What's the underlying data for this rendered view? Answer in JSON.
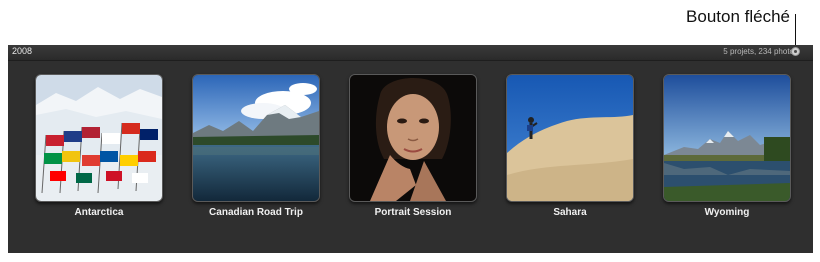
{
  "callout": {
    "label": "Bouton fléché"
  },
  "header": {
    "year": "2008",
    "summary": "5 projets, 234 photos"
  },
  "events": [
    {
      "name": "Antarctica",
      "thumbnail": "flags-on-glacier"
    },
    {
      "name": "Canadian Road Trip",
      "thumbnail": "mountain-lake"
    },
    {
      "name": "Portrait Session",
      "thumbnail": "woman-portrait"
    },
    {
      "name": "Sahara",
      "thumbnail": "desert-dune-hiker"
    },
    {
      "name": "Wyoming",
      "thumbnail": "mountain-range-reflection"
    }
  ],
  "colors": {
    "panel": "#2f2f2f",
    "header": "#333333",
    "text": "#f0f0f0"
  }
}
